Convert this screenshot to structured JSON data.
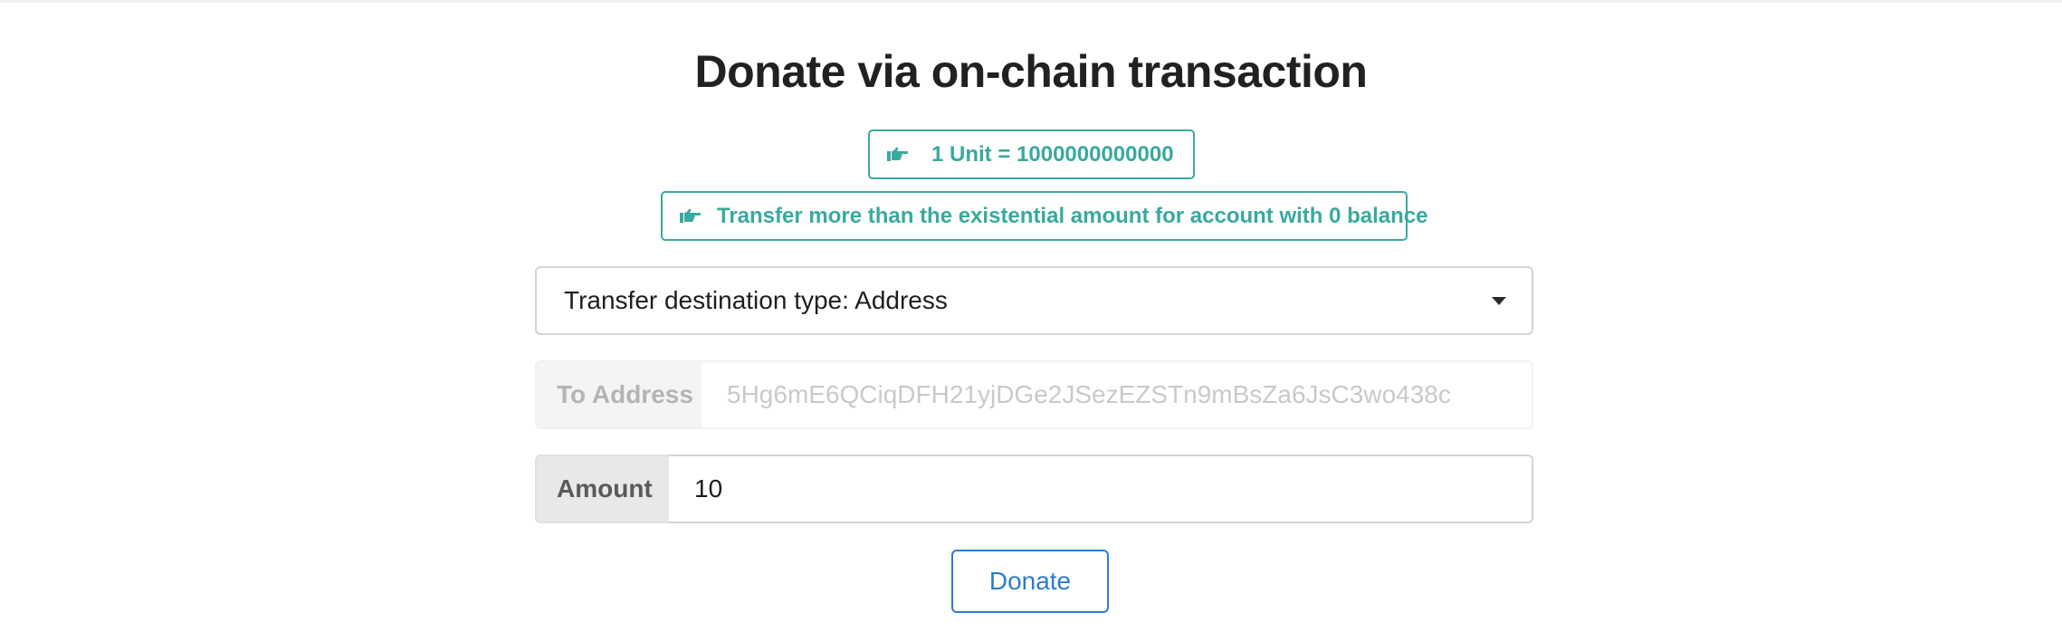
{
  "header": {
    "title": "Donate via on-chain transaction"
  },
  "notices": [
    {
      "icon": "hand-point-right-icon",
      "text": "1 Unit = 1000000000000"
    },
    {
      "icon": "hand-point-right-icon",
      "text": "Transfer more than the existential amount for account with 0 balance"
    }
  ],
  "destination_select": {
    "selected_label": "Transfer destination type: Address",
    "icon": "chevron-down-icon"
  },
  "to_address": {
    "label": "To Address",
    "value": "5Hg6mE6QCiqDFH21yjDGe2JSezEZSTn9mBsZa6JsC3wo438c",
    "disabled": true
  },
  "amount": {
    "label": "Amount",
    "value": "10"
  },
  "donate_button": {
    "label": "Donate"
  },
  "colors": {
    "accent_teal": "#3aa99f",
    "button_blue": "#2d7ccf",
    "title_text": "#212121"
  }
}
